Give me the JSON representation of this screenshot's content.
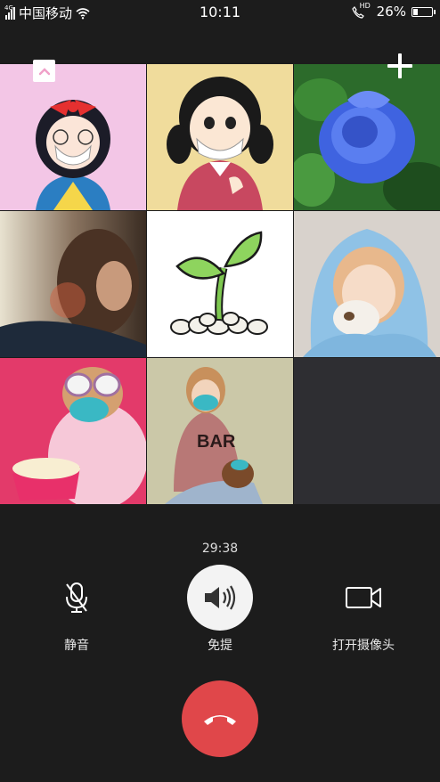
{
  "status_bar": {
    "network_label": "4G",
    "carrier": "中国移动",
    "time": "10:11",
    "hd_label": "HD",
    "battery": "26%",
    "battery_level": 0.26,
    "icons": [
      "signal-icon",
      "wifi-icon",
      "hd-call-icon",
      "battery-icon"
    ]
  },
  "call": {
    "duration": "29:38",
    "controls": [
      {
        "id": "mute",
        "label": "静音",
        "icon": "microphone-icon"
      },
      {
        "id": "speaker",
        "label": "免提",
        "icon": "speaker-icon"
      },
      {
        "id": "camera",
        "label": "打开摄像头",
        "icon": "video-camera-icon"
      }
    ],
    "hangup_icon": "hangup-icon",
    "top_icons": [
      "collapse-icon",
      "add-participant-icon"
    ]
  },
  "participants": [
    {
      "tile": 1,
      "avatar": "cartoon girl with red bow and mask",
      "bg": "#f2c4e4"
    },
    {
      "tile": 2,
      "avatar": "cartoon girl with pigtails and mask",
      "bg": "#f0dc9c"
    },
    {
      "tile": 3,
      "avatar": "blue rose",
      "bg": "#2c6e2a"
    },
    {
      "tile": 4,
      "avatar": "woman silhouette at sunset",
      "bg": "#6a5848"
    },
    {
      "tile": 5,
      "avatar": "sprout seedling drawing",
      "bg": "#ffffff"
    },
    {
      "tile": 6,
      "avatar": "girl in blue hoodie with cat",
      "bg": "#b8d4e8"
    },
    {
      "tile": 7,
      "avatar": "dog in pink robe with popcorn",
      "bg": "#e63a6a"
    },
    {
      "tile": 8,
      "avatar": "girl in BAR shirt with dog",
      "bg": "#c8c6a8",
      "shirt_text": "BAR"
    },
    {
      "tile": 9,
      "avatar": "empty",
      "bg": "#2e2e32"
    }
  ]
}
